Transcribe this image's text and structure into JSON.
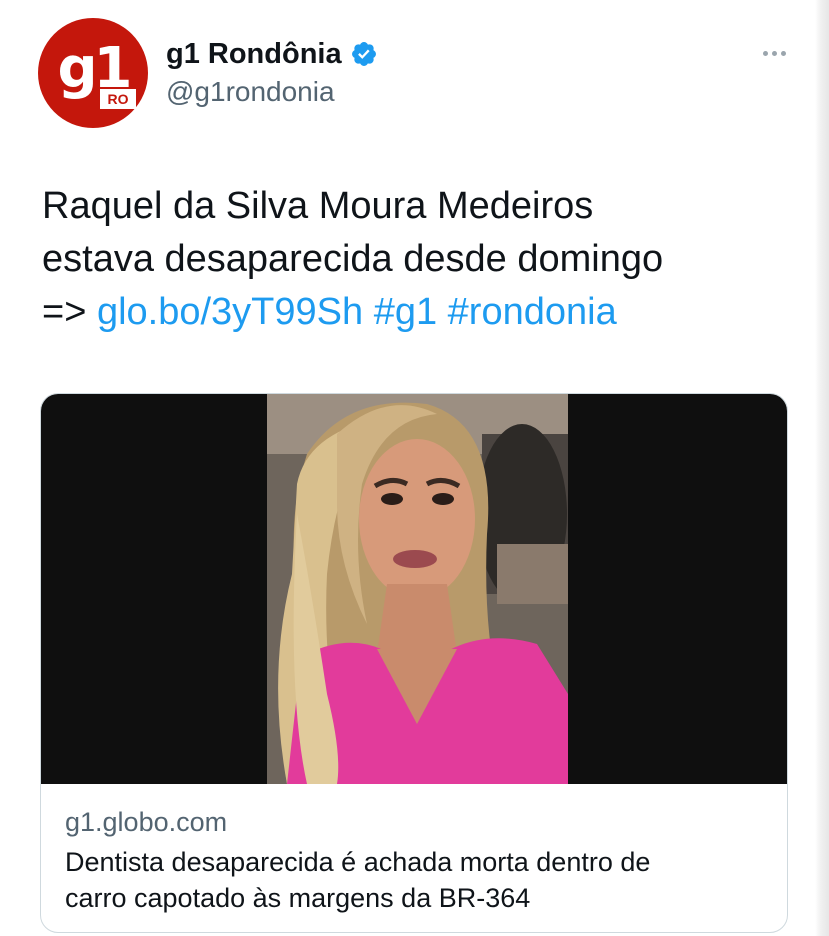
{
  "tweet": {
    "author": {
      "display_name": "g1 Rondônia",
      "handle": "@g1rondonia",
      "avatar_logo": "g1",
      "avatar_badge": "RO",
      "verified": true,
      "avatar_color": "#c4170c"
    },
    "text": {
      "line1": "Raquel da Silva Moura Medeiros",
      "line2": "estava desaparecida desde domingo",
      "line3_prefix": "=> ",
      "link": "glo.bo/3yT99Sh",
      "hashtag1": "#g1",
      "hashtag2": "#rondonia"
    },
    "card": {
      "domain": "g1.globo.com",
      "title_line1": "Dentista desaparecida é achada morta dentro de",
      "title_line2": "carro capotado às margens da BR-364",
      "image_icon": "photo-woman-pink-top"
    },
    "icons": {
      "verified": "verified-badge-icon",
      "more": "more-options-icon"
    },
    "colors": {
      "link": "#1d9bf0",
      "text": "#0f1419",
      "muted": "#536471",
      "border": "#cfd9de",
      "verified": "#1d9bf0"
    }
  }
}
